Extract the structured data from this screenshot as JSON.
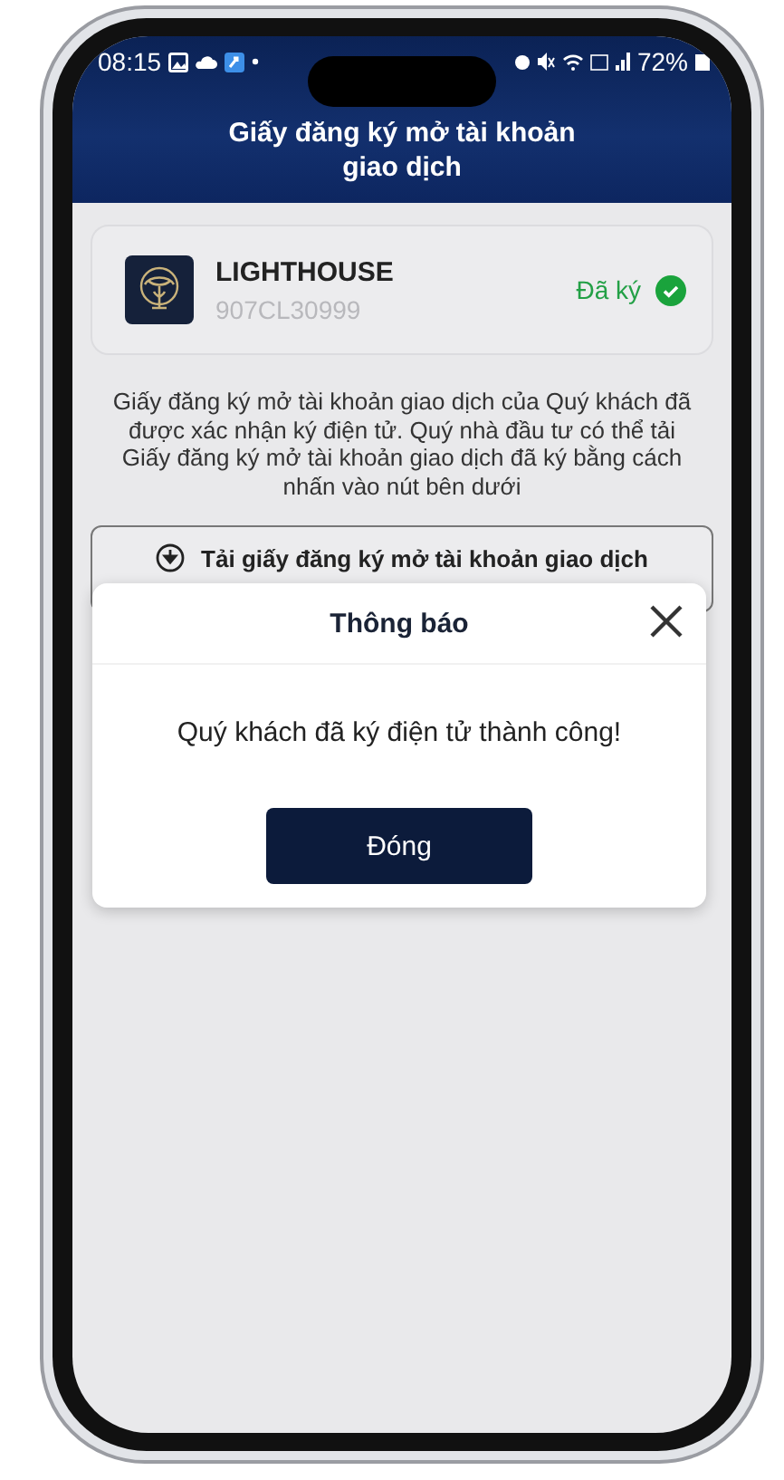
{
  "status_bar": {
    "time": "08:15",
    "battery": "72%"
  },
  "header": {
    "title": "Giấy đăng ký mở tài khoản giao dịch"
  },
  "account": {
    "name": "LIGHTHOUSE",
    "code": "907CL30999",
    "status": "Đã ký",
    "signed": true
  },
  "description": "Giấy đăng ký mở tài khoản giao dịch của Quý khách đã được xác nhận ký điện tử. Quý nhà đầu tư có thể tải Giấy đăng ký mở tài khoản giao dịch đã ký bằng cách nhấn vào nút bên dưới",
  "download_button": {
    "label": "Tải giấy đăng ký mở tài khoản giao dịch"
  },
  "dialog": {
    "title": "Thông báo",
    "message": "Quý khách đã ký điện tử thành công!",
    "close_button": "Đóng"
  }
}
